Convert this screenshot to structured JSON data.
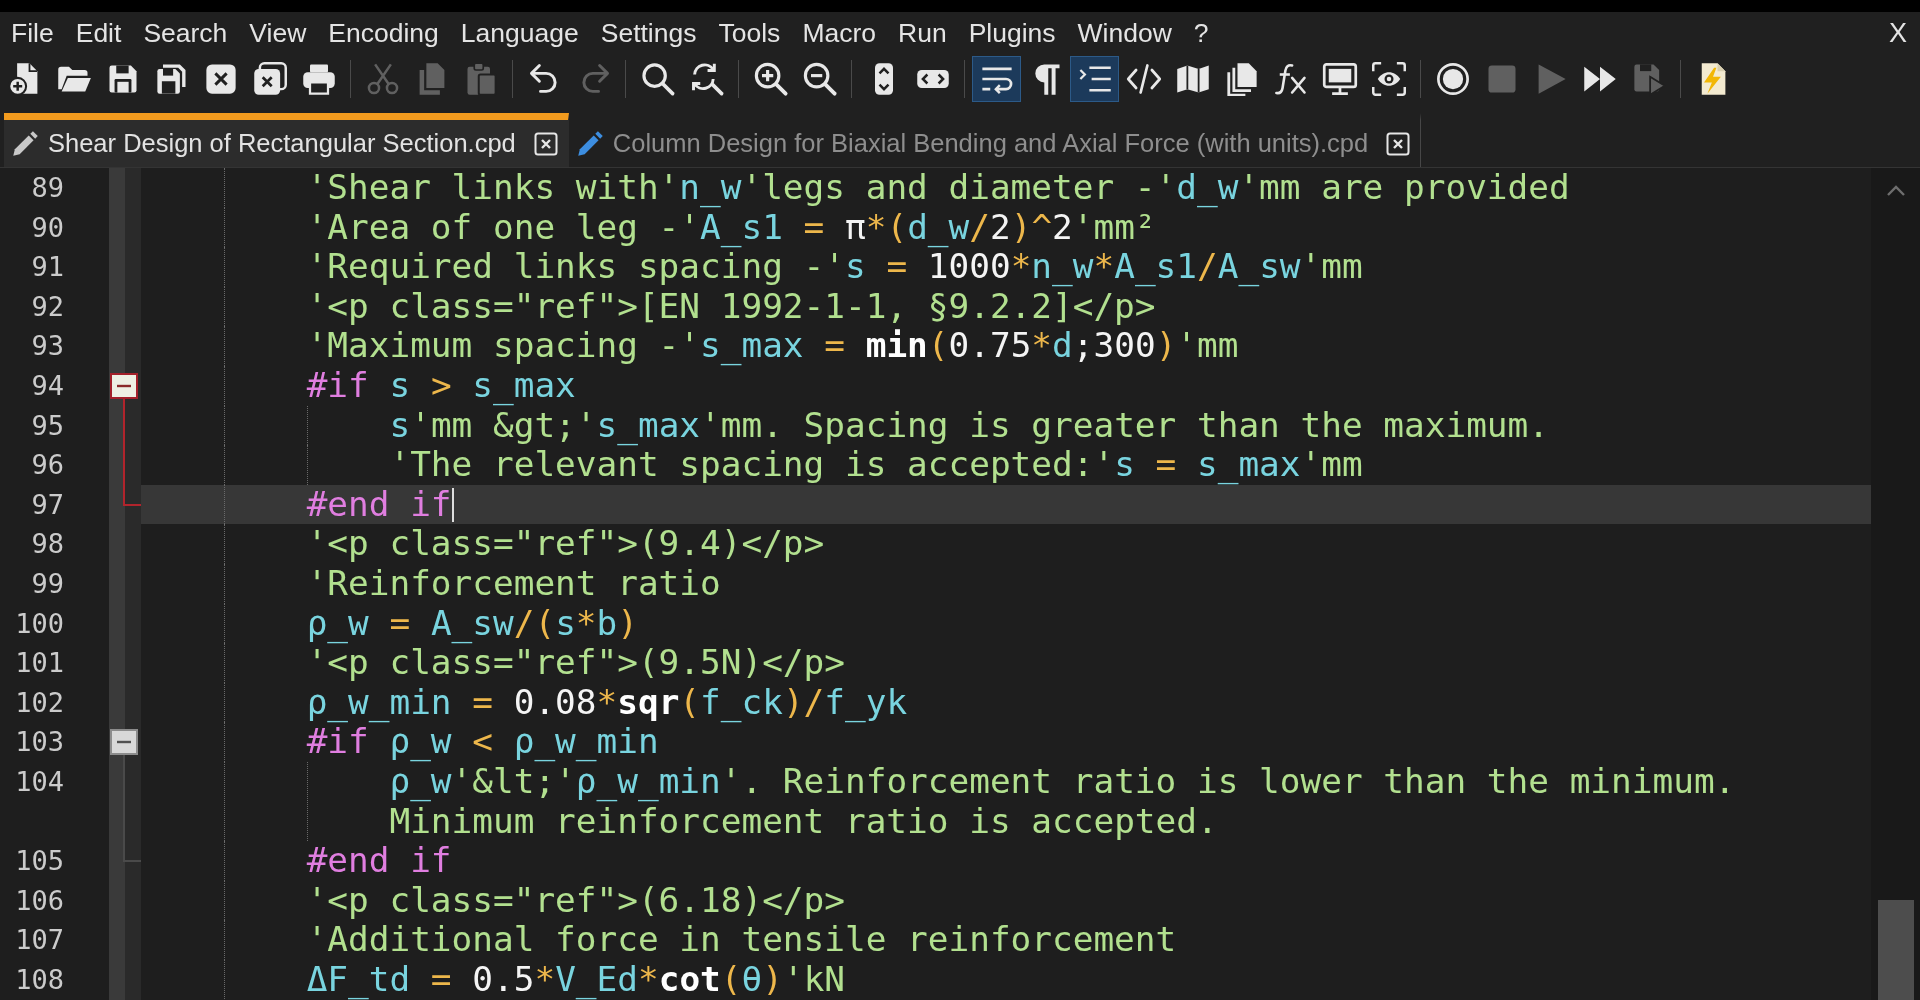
{
  "menu": {
    "items": [
      {
        "label": "File"
      },
      {
        "label": "Edit"
      },
      {
        "label": "Search"
      },
      {
        "label": "View"
      },
      {
        "label": "Encoding"
      },
      {
        "label": "Language"
      },
      {
        "label": "Settings"
      },
      {
        "label": "Tools"
      },
      {
        "label": "Macro"
      },
      {
        "label": "Run"
      },
      {
        "label": "Plugins"
      },
      {
        "label": "Window"
      },
      {
        "label": "?"
      }
    ],
    "close_label": "X"
  },
  "toolbar": {
    "groups": [
      [
        {
          "disabled": false,
          "checked": false
        },
        {
          "disabled": false,
          "checked": false
        },
        {
          "disabled": false,
          "checked": false
        },
        {
          "disabled": false,
          "checked": false
        },
        {
          "disabled": false,
          "checked": false
        },
        {
          "disabled": false,
          "checked": false
        },
        {
          "disabled": false,
          "checked": false
        }
      ],
      [
        {
          "disabled": true,
          "checked": false
        },
        {
          "disabled": true,
          "checked": false
        },
        {
          "disabled": true,
          "checked": false
        }
      ],
      [
        {
          "disabled": false,
          "checked": false
        },
        {
          "disabled": true,
          "checked": false
        }
      ],
      [
        {
          "disabled": false,
          "checked": false
        },
        {
          "disabled": false,
          "checked": false
        }
      ],
      [
        {
          "disabled": false,
          "checked": false
        },
        {
          "disabled": false,
          "checked": false
        }
      ],
      [
        {
          "disabled": false,
          "checked": false
        },
        {
          "disabled": false,
          "checked": false
        }
      ],
      [
        {
          "disabled": false,
          "checked": true
        },
        {
          "disabled": false,
          "checked": false
        },
        {
          "disabled": false,
          "checked": true
        },
        {
          "disabled": false,
          "checked": false
        },
        {
          "disabled": false,
          "checked": false
        },
        {
          "disabled": false,
          "checked": false
        },
        {
          "disabled": false,
          "checked": false
        },
        {
          "disabled": false,
          "checked": false
        },
        {
          "disabled": false,
          "checked": false
        }
      ],
      [
        {
          "disabled": false,
          "checked": false
        },
        {
          "disabled": true,
          "checked": false
        },
        {
          "disabled": true,
          "checked": false
        },
        {
          "disabled": false,
          "checked": false
        },
        {
          "disabled": true,
          "checked": false
        }
      ],
      [
        {
          "disabled": false,
          "checked": false
        }
      ]
    ]
  },
  "tabs": [
    {
      "label": "Shear Design of Rectangular Section.cpd",
      "selected": true,
      "color": "#c8c8c8"
    },
    {
      "label": "Column Design for Biaxial Bending and Axial Force (with units).cpd",
      "selected": false,
      "color": "#3d8ee0"
    }
  ],
  "editor": {
    "lines": [
      {
        "number": "89",
        "current": false,
        "tokens": [
          {
            "kind": "string",
            "text": "'Shear links with'"
          },
          {
            "kind": "variable",
            "text": "n_w"
          },
          {
            "kind": "string",
            "text": "'legs and diameter -'"
          },
          {
            "kind": "variable",
            "text": "d_w"
          },
          {
            "kind": "string",
            "text": "'mm are provided"
          }
        ]
      },
      {
        "number": "90",
        "current": false,
        "tokens": [
          {
            "kind": "string",
            "text": "'Area of one leg -'"
          },
          {
            "kind": "variable",
            "text": "A_s1"
          },
          {
            "kind": "operator",
            "text": " = "
          },
          {
            "kind": "number",
            "text": "π"
          },
          {
            "kind": "operator",
            "text": "*("
          },
          {
            "kind": "variable",
            "text": "d_w"
          },
          {
            "kind": "operator",
            "text": "/"
          },
          {
            "kind": "number",
            "text": "2"
          },
          {
            "kind": "operator",
            "text": ")^"
          },
          {
            "kind": "number",
            "text": "2"
          },
          {
            "kind": "string",
            "text": "'mm²"
          }
        ]
      },
      {
        "number": "91",
        "current": false,
        "tokens": [
          {
            "kind": "string",
            "text": "'Required links spacing -'"
          },
          {
            "kind": "variable",
            "text": "s"
          },
          {
            "kind": "operator",
            "text": " = "
          },
          {
            "kind": "number",
            "text": "1000"
          },
          {
            "kind": "operator",
            "text": "*"
          },
          {
            "kind": "variable",
            "text": "n_w"
          },
          {
            "kind": "operator",
            "text": "*"
          },
          {
            "kind": "variable",
            "text": "A_s1"
          },
          {
            "kind": "operator",
            "text": "/"
          },
          {
            "kind": "variable",
            "text": "A_sw"
          },
          {
            "kind": "string",
            "text": "'mm"
          }
        ]
      },
      {
        "number": "92",
        "current": false,
        "tokens": [
          {
            "kind": "string",
            "text": "'<p class=\"ref\">[EN 1992-1-1, §9.2.2]</p>"
          }
        ]
      },
      {
        "number": "93",
        "current": false,
        "tokens": [
          {
            "kind": "string",
            "text": "'Maximum spacing -'"
          },
          {
            "kind": "variable",
            "text": "s_max"
          },
          {
            "kind": "operator",
            "text": " = "
          },
          {
            "kind": "function",
            "text": "min"
          },
          {
            "kind": "operator",
            "text": "("
          },
          {
            "kind": "number",
            "text": "0.75"
          },
          {
            "kind": "operator",
            "text": "*"
          },
          {
            "kind": "variable",
            "text": "d"
          },
          {
            "kind": "plain",
            "text": ";"
          },
          {
            "kind": "number",
            "text": "300"
          },
          {
            "kind": "operator",
            "text": ")"
          },
          {
            "kind": "string",
            "text": "'mm"
          }
        ]
      },
      {
        "number": "94",
        "current": false,
        "expanded": true,
        "tokens": [
          {
            "kind": "keyword",
            "text": "#if "
          },
          {
            "kind": "variable",
            "text": "s"
          },
          {
            "kind": "operator",
            "text": " > "
          },
          {
            "kind": "variable",
            "text": "s_max"
          }
        ],
        "children": [
          {
            "number": "95",
            "current": false,
            "tokens": [
              {
                "kind": "variable",
                "text": "s"
              },
              {
                "kind": "string",
                "text": "'mm &gt;'"
              },
              {
                "kind": "variable",
                "text": "s_max"
              },
              {
                "kind": "string",
                "text": "'mm. Spacing is greater than the maximum."
              }
            ]
          },
          {
            "number": "96",
            "current": false,
            "tokens": [
              {
                "kind": "string",
                "text": "'The relevant spacing is accepted:'"
              },
              {
                "kind": "variable",
                "text": "s"
              },
              {
                "kind": "operator",
                "text": " = "
              },
              {
                "kind": "variable",
                "text": "s_max"
              },
              {
                "kind": "string",
                "text": "'mm"
              }
            ]
          }
        ]
      },
      {
        "number": "97",
        "current": true,
        "tokens": [
          {
            "kind": "keyword",
            "text": "#end if"
          }
        ]
      },
      {
        "number": "98",
        "current": false,
        "tokens": [
          {
            "kind": "string",
            "text": "'<p class=\"ref\">(9.4)</p>"
          }
        ]
      },
      {
        "number": "99",
        "current": false,
        "tokens": [
          {
            "kind": "string",
            "text": "'Reinforcement ratio"
          }
        ]
      },
      {
        "number": "100",
        "current": false,
        "tokens": [
          {
            "kind": "variable",
            "text": "ρ_w"
          },
          {
            "kind": "operator",
            "text": " = "
          },
          {
            "kind": "variable",
            "text": "A_sw"
          },
          {
            "kind": "operator",
            "text": "/("
          },
          {
            "kind": "variable",
            "text": "s"
          },
          {
            "kind": "operator",
            "text": "*"
          },
          {
            "kind": "variable",
            "text": "b"
          },
          {
            "kind": "operator",
            "text": ")"
          }
        ]
      },
      {
        "number": "101",
        "current": false,
        "tokens": [
          {
            "kind": "string",
            "text": "'<p class=\"ref\">(9.5N)</p>"
          }
        ]
      },
      {
        "number": "102",
        "current": false,
        "tokens": [
          {
            "kind": "variable",
            "text": "ρ_w_min"
          },
          {
            "kind": "operator",
            "text": " = "
          },
          {
            "kind": "number",
            "text": "0.08"
          },
          {
            "kind": "operator",
            "text": "*"
          },
          {
            "kind": "function",
            "text": "sqr"
          },
          {
            "kind": "operator",
            "text": "("
          },
          {
            "kind": "variable",
            "text": "f_ck"
          },
          {
            "kind": "operator",
            "text": ")/"
          },
          {
            "kind": "variable",
            "text": "f_yk"
          }
        ]
      },
      {
        "number": "103",
        "current": false,
        "expanded": true,
        "tokens": [
          {
            "kind": "keyword",
            "text": "#if "
          },
          {
            "kind": "variable",
            "text": "ρ_w"
          },
          {
            "kind": "operator",
            "text": " < "
          },
          {
            "kind": "variable",
            "text": "ρ_w_min"
          }
        ],
        "children": [
          {
            "number": "104",
            "current": false,
            "tokens": [
              {
                "kind": "variable",
                "text": "ρ_w"
              },
              {
                "kind": "string",
                "text": "'&lt;'"
              },
              {
                "kind": "variable",
                "text": "ρ_w_min"
              },
              {
                "kind": "string",
                "text": "'. Reinforcement ratio is lower than the minimum. Minimum reinforcement ratio is accepted."
              }
            ]
          }
        ]
      },
      {
        "number": "105",
        "current": false,
        "tokens": [
          {
            "kind": "keyword",
            "text": "#end if"
          }
        ]
      },
      {
        "number": "106",
        "current": false,
        "tokens": [
          {
            "kind": "string",
            "text": "'<p class=\"ref\">(6.18)</p>"
          }
        ]
      },
      {
        "number": "107",
        "current": false,
        "tokens": [
          {
            "kind": "string",
            "text": "'Additional force in tensile reinforcement"
          }
        ]
      },
      {
        "number": "108",
        "current": false,
        "tokens": [
          {
            "kind": "variable",
            "text": "ΔF_td"
          },
          {
            "kind": "operator",
            "text": " = "
          },
          {
            "kind": "number",
            "text": "0.5"
          },
          {
            "kind": "operator",
            "text": "*"
          },
          {
            "kind": "variable",
            "text": "V_Ed"
          },
          {
            "kind": "operator",
            "text": "*"
          },
          {
            "kind": "function",
            "text": "cot"
          },
          {
            "kind": "operator",
            "text": "("
          },
          {
            "kind": "variable",
            "text": "θ"
          },
          {
            "kind": "operator",
            "text": ")"
          },
          {
            "kind": "string",
            "text": "'kN"
          }
        ]
      }
    ]
  }
}
